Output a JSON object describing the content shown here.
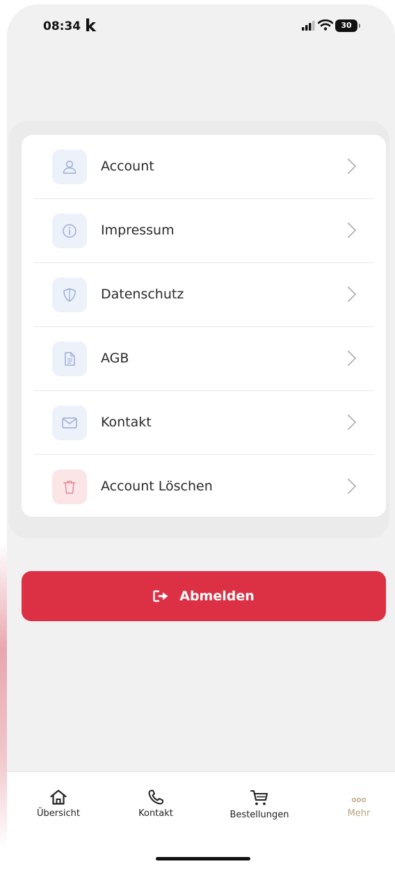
{
  "status_bar": {
    "time": "08:34",
    "brand_glyph": "k",
    "battery": "30"
  },
  "menu": {
    "items": [
      {
        "label": "Account",
        "icon": "user-icon"
      },
      {
        "label": "Impressum",
        "icon": "info-icon"
      },
      {
        "label": "Datenschutz",
        "icon": "shield-icon"
      },
      {
        "label": "AGB",
        "icon": "document-icon"
      },
      {
        "label": "Kontakt",
        "icon": "mail-icon"
      },
      {
        "label": "Account Löschen",
        "icon": "trash-icon"
      }
    ]
  },
  "logout": {
    "label": "Abmelden",
    "icon": "logout-icon"
  },
  "tabbar": {
    "items": [
      {
        "label": "Übersicht",
        "icon": "home-icon"
      },
      {
        "label": "Kontakt",
        "icon": "phone-icon"
      },
      {
        "label": "Bestellungen",
        "icon": "cart-icon"
      },
      {
        "label": "Mehr",
        "icon": "more-icon"
      }
    ],
    "active": "Mehr"
  },
  "colors": {
    "accent_red": "#dc3045",
    "icon_blue": "#9aaed6",
    "icon_red": "#e58a95",
    "tab_active": "#b9a47d"
  }
}
